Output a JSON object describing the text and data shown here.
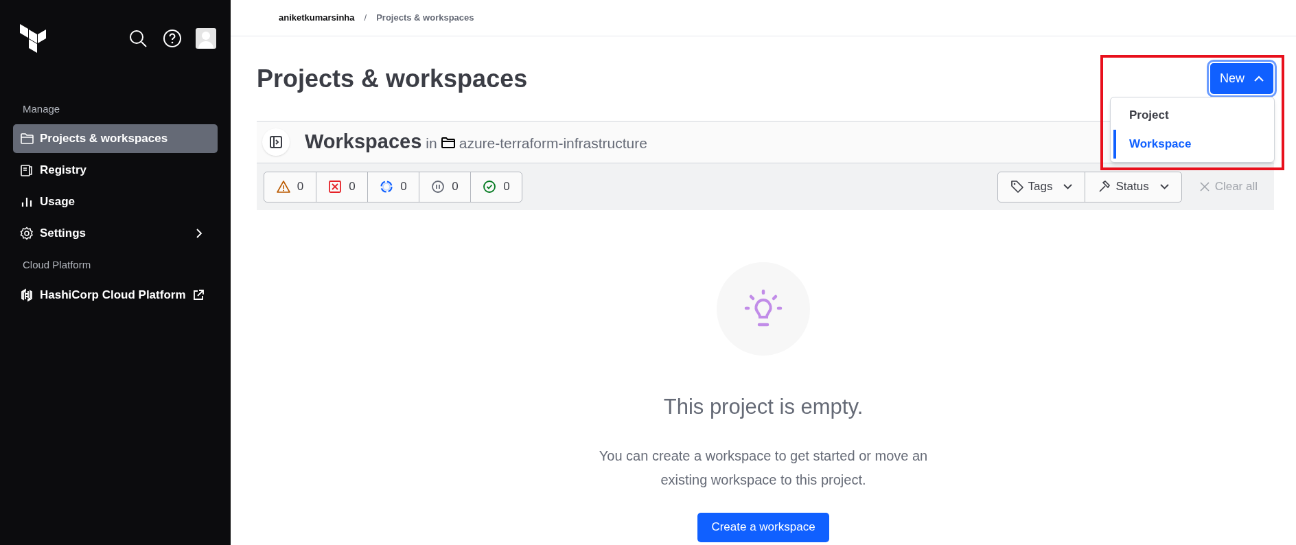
{
  "breadcrumb": {
    "separator": "/",
    "items": [
      "aniketkumarsinha",
      "Projects & workspaces"
    ]
  },
  "sidebar": {
    "sections": [
      {
        "heading": "Manage",
        "items": [
          {
            "label": "Projects & workspaces",
            "kind": "folder",
            "selected": true
          },
          {
            "label": "Registry",
            "kind": "registry",
            "selected": false
          },
          {
            "label": "Usage",
            "kind": "usage",
            "selected": false
          },
          {
            "label": "Settings",
            "kind": "settings",
            "selected": false,
            "submenu": true
          }
        ]
      },
      {
        "heading": "Cloud Platform",
        "items": [
          {
            "label": "HashiCorp Cloud Platform",
            "kind": "hcp",
            "selected": false,
            "external": true
          }
        ]
      }
    ]
  },
  "page_title": "Projects & workspaces",
  "new_button": {
    "label": "New",
    "expanded": true
  },
  "new_menu": [
    {
      "label": "Project",
      "selected": false
    },
    {
      "label": "Workspace",
      "selected": true
    }
  ],
  "workspaces_header": {
    "title": "Workspaces",
    "in": "in",
    "project": "azure-terraform-infrastructure"
  },
  "status_filters": [
    {
      "kind": "warning",
      "count": "0"
    },
    {
      "kind": "error",
      "count": "0"
    },
    {
      "kind": "running",
      "count": "0"
    },
    {
      "kind": "paused",
      "count": "0"
    },
    {
      "kind": "success",
      "count": "0"
    }
  ],
  "filter_buttons": [
    {
      "kind": "tags",
      "label": "Tags"
    },
    {
      "kind": "status",
      "label": "Status"
    }
  ],
  "clear_all": "Clear all",
  "empty_state": {
    "title": "This project is empty.",
    "message": "You can create a workspace to get started or move an existing workspace to this project.",
    "button": "Create a workspace"
  }
}
